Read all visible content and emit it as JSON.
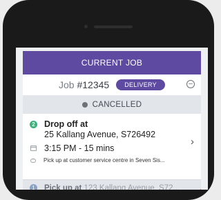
{
  "header": {
    "title": "CURRENT JOB"
  },
  "job": {
    "label": "Job",
    "number": "#12345",
    "badge": "DELIVERY"
  },
  "status": {
    "text": "CANCELLED"
  },
  "stop": {
    "number": "2",
    "title": "Drop off at",
    "address": "25 Kallang Avenue, S726492",
    "time": "3:15 PM - 15 mins",
    "note": "Pick up at customer service centre in Seven Sis..."
  },
  "next_stop": {
    "number": "1",
    "label": "Pick up at",
    "address": "123 Kallang Avenue, S72..."
  },
  "colors": {
    "brand": "#5e4ba1",
    "success": "#3ab27a",
    "alert": "#e0334a"
  }
}
